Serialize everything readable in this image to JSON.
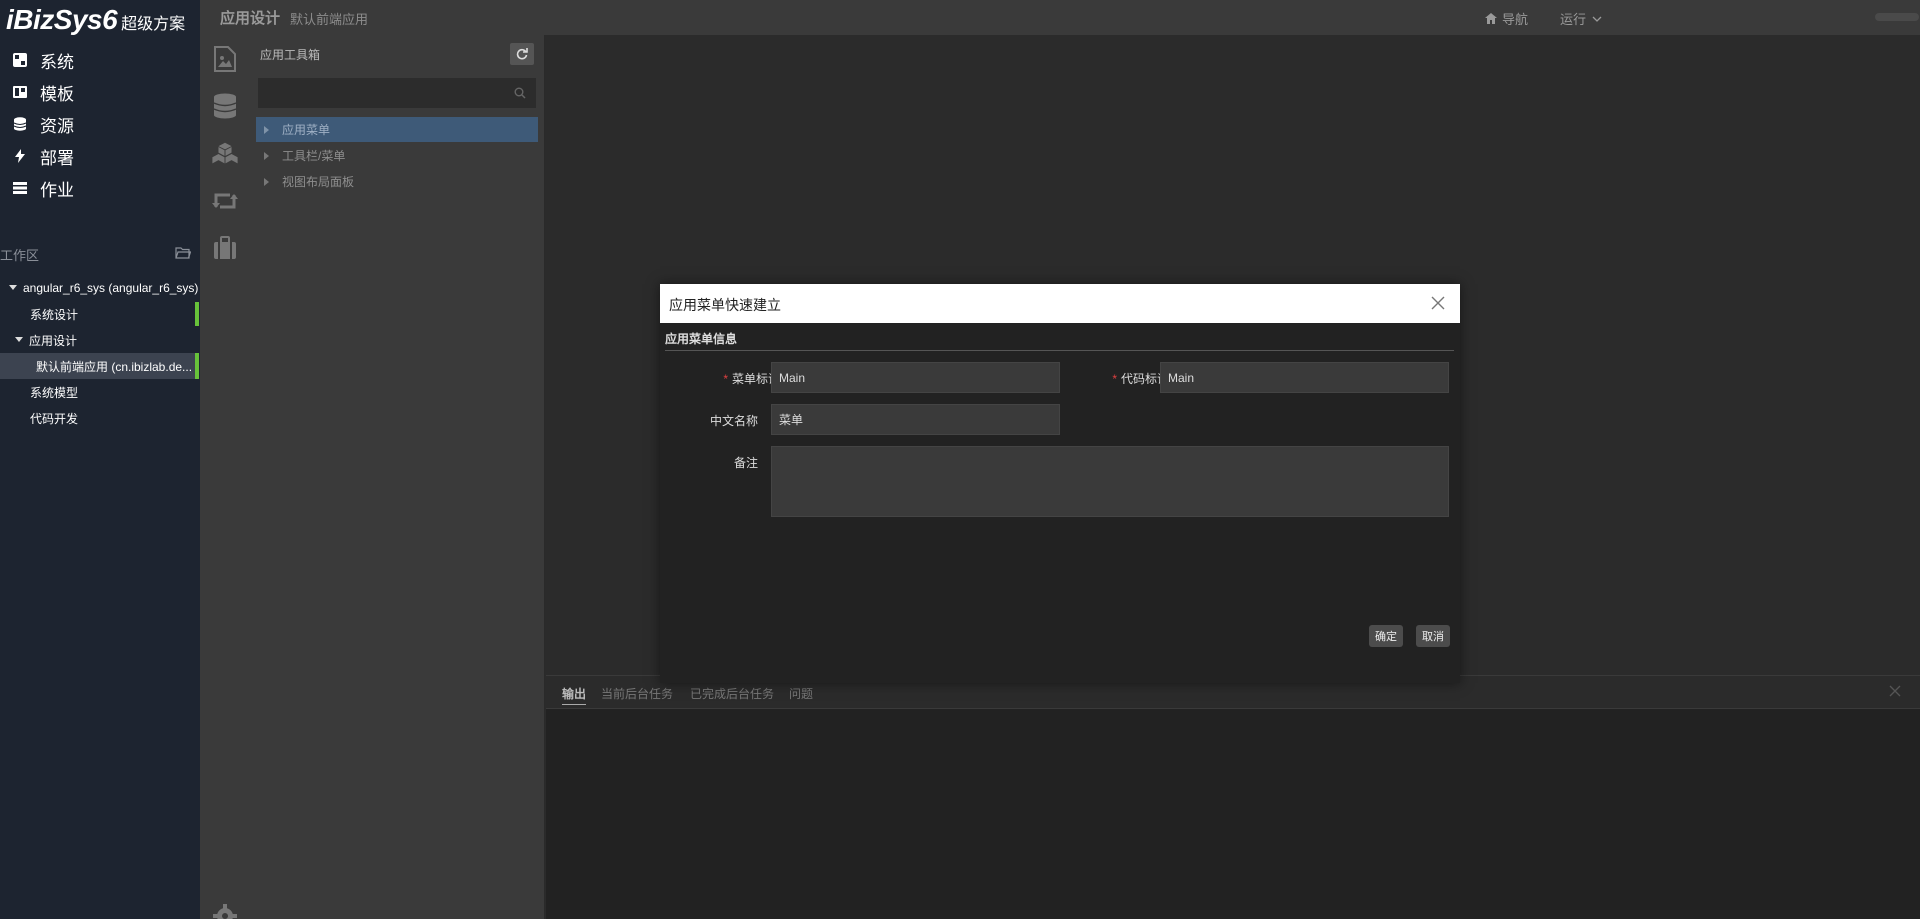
{
  "brand": {
    "logo": "iBizSys6",
    "subtitle": "超级方案"
  },
  "nav": [
    {
      "label": "系统",
      "icon": "dashboard-icon"
    },
    {
      "label": "模板",
      "icon": "template-icon"
    },
    {
      "label": "资源",
      "icon": "database-icon"
    },
    {
      "label": "部署",
      "icon": "bolt-icon"
    },
    {
      "label": "作业",
      "icon": "server-icon"
    }
  ],
  "workspace": {
    "title": "工作区",
    "tree": {
      "root": "angular_r6_sys (angular_r6_sys)",
      "sys_design": "系统设计",
      "app_design": "应用设计",
      "default_app": "默认前端应用 (cn.ibizlab.de...",
      "sys_model": "系统模型",
      "code_dev": "代码开发"
    }
  },
  "topbar": {
    "title": "应用设计",
    "subtitle": "默认前端应用",
    "nav_label": "导航",
    "run_label": "运行"
  },
  "toolbox": {
    "title": "应用工具箱",
    "search_placeholder": "",
    "items": [
      "应用菜单",
      "工具栏/菜单",
      "视图布局面板"
    ]
  },
  "output": {
    "tabs": [
      "输出",
      "当前后台任务",
      "已完成后台任务",
      "问题"
    ]
  },
  "modal": {
    "title": "应用菜单快速建立",
    "section": "应用菜单信息",
    "fields": {
      "menu_id_label": "菜单标识",
      "menu_id_value": "Main",
      "code_id_label": "代码标识",
      "code_id_value": "Main",
      "cn_name_label": "中文名称",
      "cn_name_value": "菜单",
      "remark_label": "备注",
      "remark_value": ""
    },
    "ok_label": "确定",
    "cancel_label": "取消"
  },
  "colors": {
    "accent_green": "#67c23a",
    "selected_blue": "#3e5a78",
    "required_red": "#e04040"
  }
}
